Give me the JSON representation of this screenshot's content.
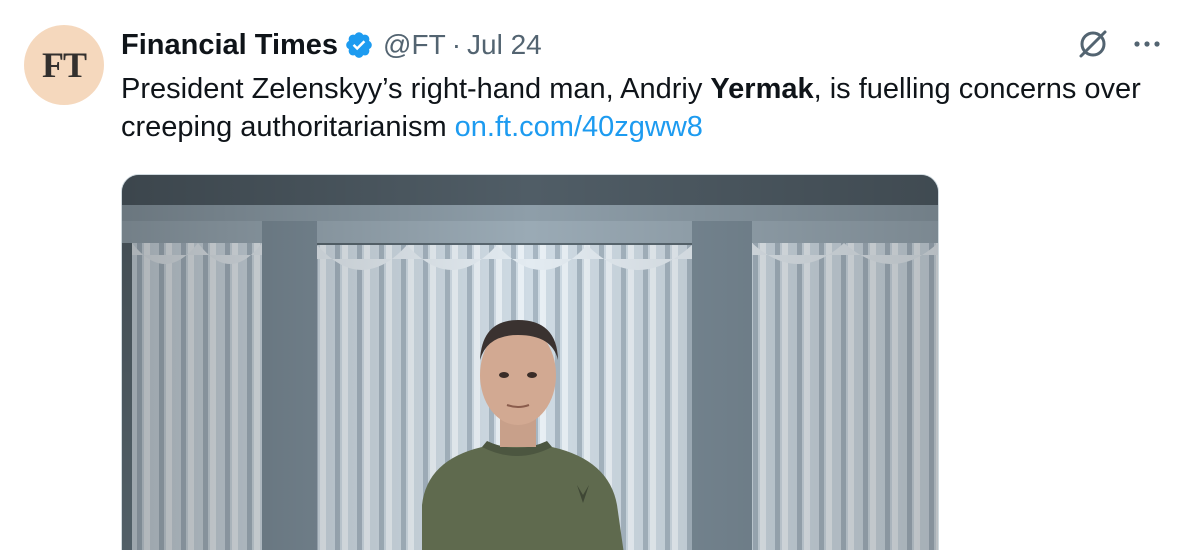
{
  "author": {
    "avatar_text": "FT",
    "name": "Financial Times",
    "handle": "@FT",
    "separator": "·",
    "date": "Jul 24",
    "verified": true,
    "avatar_color": "#f5d8bd"
  },
  "tweet": {
    "text_before": "President Zelenskyy’s right-hand man, Andriy ",
    "text_bold": "Yermak",
    "text_after": ", is fuelling concerns over creeping authoritarianism ",
    "link": "on.ft.com/40zgww8"
  },
  "actions": {
    "grok_icon": "slashed-circle-icon",
    "more_icon": "more-dots-icon"
  },
  "colors": {
    "link": "#1d9bf0",
    "verified": "#1d9bf0",
    "text": "#0f1419",
    "muted": "#536471"
  }
}
